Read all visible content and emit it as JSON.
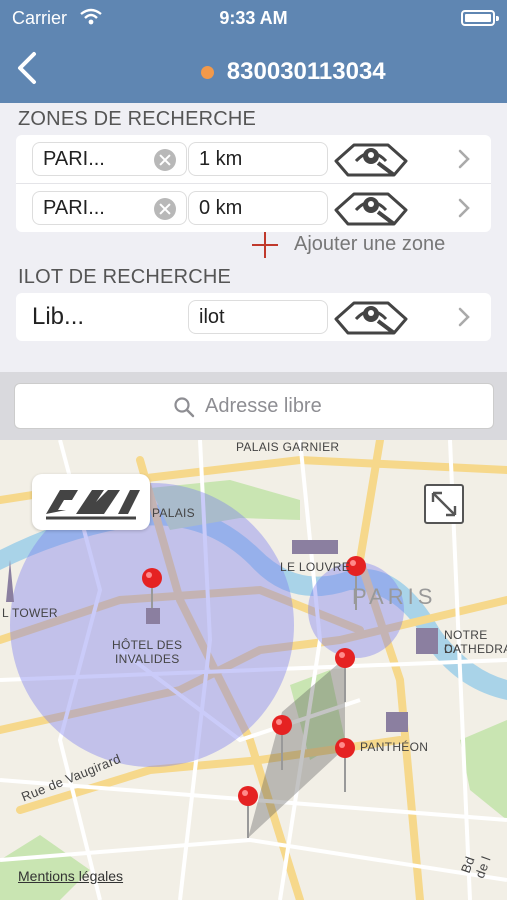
{
  "status": {
    "carrier": "Carrier",
    "time": "9:33 AM"
  },
  "nav": {
    "title": "830030113034",
    "back_icon": "chevron-left-icon",
    "dot_color": "#f2994a"
  },
  "zones": {
    "label": "ZONES DE RECHERCHE",
    "rows": [
      {
        "place": "PARI...",
        "radius": "1 km"
      },
      {
        "place": "PARI...",
        "radius": "0 km"
      }
    ],
    "add_label": "Ajouter une zone"
  },
  "ilot": {
    "label": "ILOT DE RECHERCHE",
    "place": "Lib...",
    "value": "ilot"
  },
  "search": {
    "placeholder": "Adresse libre"
  },
  "map": {
    "labels": {
      "palais_garnier": "PALAIS GARNIER",
      "palais": "PALAIS",
      "louvre": "LE LOUVRE",
      "paris": "PARIS",
      "tower": "L TOWER",
      "invalides_1": "HÔTEL DES",
      "invalides_2": "INVALIDES",
      "notre_dame_1": "NOTRE DA",
      "notre_dame_2": "CATHEDRA",
      "pantheon": "PANTHÉON",
      "vaugirard": "Rue de Vaugirard",
      "bd": "Bd de l"
    },
    "legal": "Mentions légales"
  }
}
